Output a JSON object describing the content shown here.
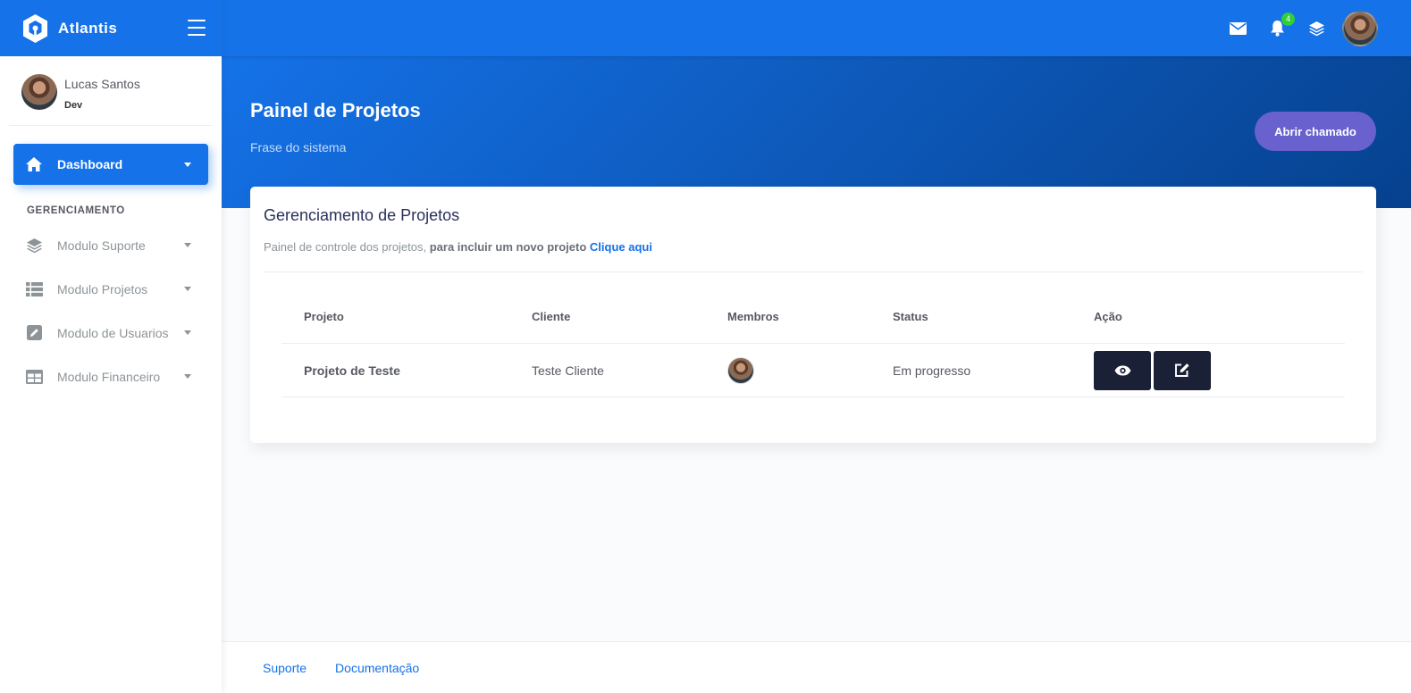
{
  "brand": {
    "name": "Atlantis"
  },
  "user": {
    "name": "Lucas Santos",
    "role": "Dev"
  },
  "sidebar": {
    "active_item": {
      "label": "Dashboard",
      "icon": "home-icon"
    },
    "section_title": "GERENCIAMENTO",
    "items": [
      {
        "label": "Modulo Suporte",
        "icon": "layers-icon"
      },
      {
        "label": "Modulo Projetos",
        "icon": "table-icon"
      },
      {
        "label": "Modulo de Usuarios",
        "icon": "edit-icon"
      },
      {
        "label": "Modulo Financeiro",
        "icon": "grid-icon"
      }
    ]
  },
  "topbar": {
    "notification_count": "4"
  },
  "header": {
    "title": "Painel de Projetos",
    "subtitle": "Frase do sistema",
    "button_label": "Abrir chamado"
  },
  "card": {
    "title": "Gerenciamento de Projetos",
    "desc_plain": "Painel de controle dos projetos, ",
    "desc_bold": "para incluir um novo projeto",
    "desc_link": "Clique aqui",
    "table": {
      "headers": [
        "Projeto",
        "Cliente",
        "Membros",
        "Status",
        "Ação"
      ],
      "rows": [
        {
          "projeto": "Projeto de Teste",
          "cliente": "Teste Cliente",
          "status": "Em progresso"
        }
      ]
    }
  },
  "footer": {
    "links": [
      "Suporte",
      "Documentação"
    ]
  },
  "colors": {
    "primary": "#1572e8",
    "secondary": "#6861ce",
    "dark": "#1a2035",
    "success": "#31ce36"
  }
}
